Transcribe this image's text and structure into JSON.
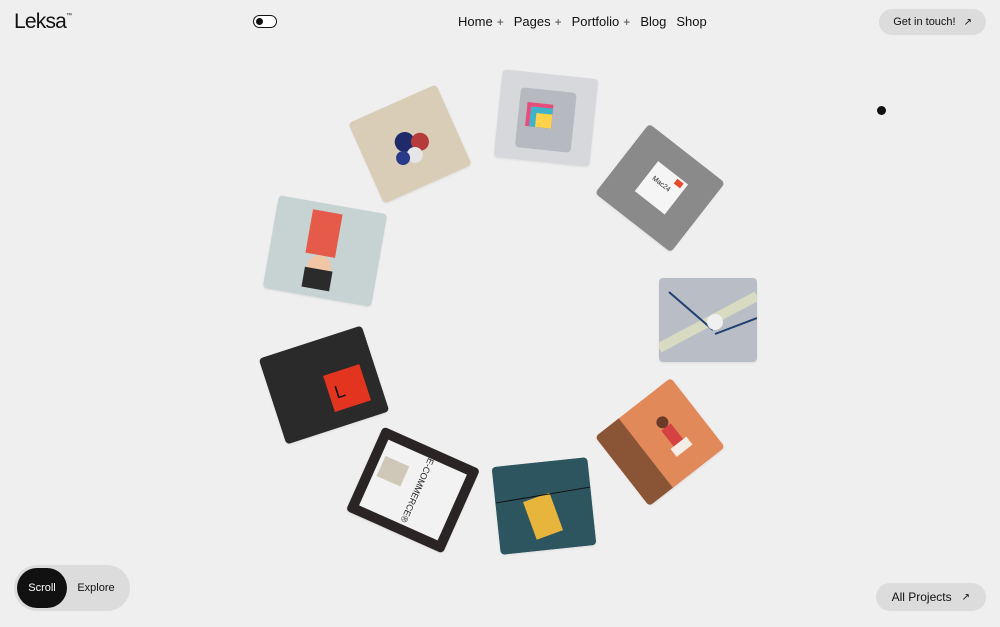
{
  "brand": {
    "name": "Leksa",
    "mark": "™"
  },
  "nav": {
    "items": [
      {
        "label": "Home",
        "has_submenu": true
      },
      {
        "label": "Pages",
        "has_submenu": true
      },
      {
        "label": "Portfolio",
        "has_submenu": true
      },
      {
        "label": "Blog",
        "has_submenu": false
      },
      {
        "label": "Shop",
        "has_submenu": false
      }
    ],
    "submenu_glyph": "+"
  },
  "cta": {
    "label": "Get in touch!",
    "icon": "arrow-up-right-icon"
  },
  "theme_toggle": {
    "state": "light"
  },
  "gallery": {
    "items": [
      {
        "name": "stickers-project",
        "colors": [
          "#d9cdb7",
          "#b2a690"
        ]
      },
      {
        "name": "foil-packaging-project",
        "colors": [
          "#d6d8dc",
          "#a7aab1"
        ]
      },
      {
        "name": "box-mockup-project",
        "colors": [
          "#8a8a8a",
          "#2b2b2b"
        ]
      },
      {
        "name": "tape-project",
        "colors": [
          "#b9bec6",
          "#8f96a3"
        ]
      },
      {
        "name": "fashion-photo-project",
        "colors": [
          "#e2895a",
          "#8a5536"
        ]
      },
      {
        "name": "poster-project",
        "colors": [
          "#3f6b78",
          "#1e3137"
        ]
      },
      {
        "name": "ecommerce-project",
        "colors": [
          "#3a3232",
          "#1a1616"
        ]
      },
      {
        "name": "red-card-project",
        "colors": [
          "#3a3a3a",
          "#141414"
        ]
      },
      {
        "name": "portrait-project",
        "colors": [
          "#c7d3d2",
          "#a0b3b1"
        ]
      }
    ],
    "overlay_texts": {
      "ecommerce": "E-COMMERCE®",
      "box": "Mac24"
    }
  },
  "switcher": {
    "active": "Scroll",
    "inactive": "Explore"
  },
  "all_projects": {
    "label": "All Projects",
    "icon": "arrow-up-right-icon"
  }
}
